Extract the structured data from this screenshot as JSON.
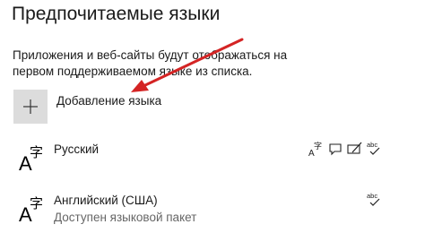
{
  "page": {
    "title": "Предпочитаемые языки",
    "description": "Приложения и веб-сайты будут отображаться на первом поддерживаемом языке из списка."
  },
  "add_language": {
    "label": "Добавление языка",
    "icon": "plus-icon"
  },
  "languages": [
    {
      "name": "Русский",
      "status": "",
      "icon": "language-glyph-icon",
      "features": [
        "display-language-icon",
        "speech-icon",
        "handwriting-icon",
        "spellcheck-icon"
      ]
    },
    {
      "name": "Английский (США)",
      "status": "Доступен языковой пакет",
      "icon": "language-glyph-icon",
      "features": [
        "spellcheck-icon"
      ]
    }
  ],
  "annotation": {
    "arrow_color": "#d42424",
    "icon": "red-arrow-icon"
  }
}
